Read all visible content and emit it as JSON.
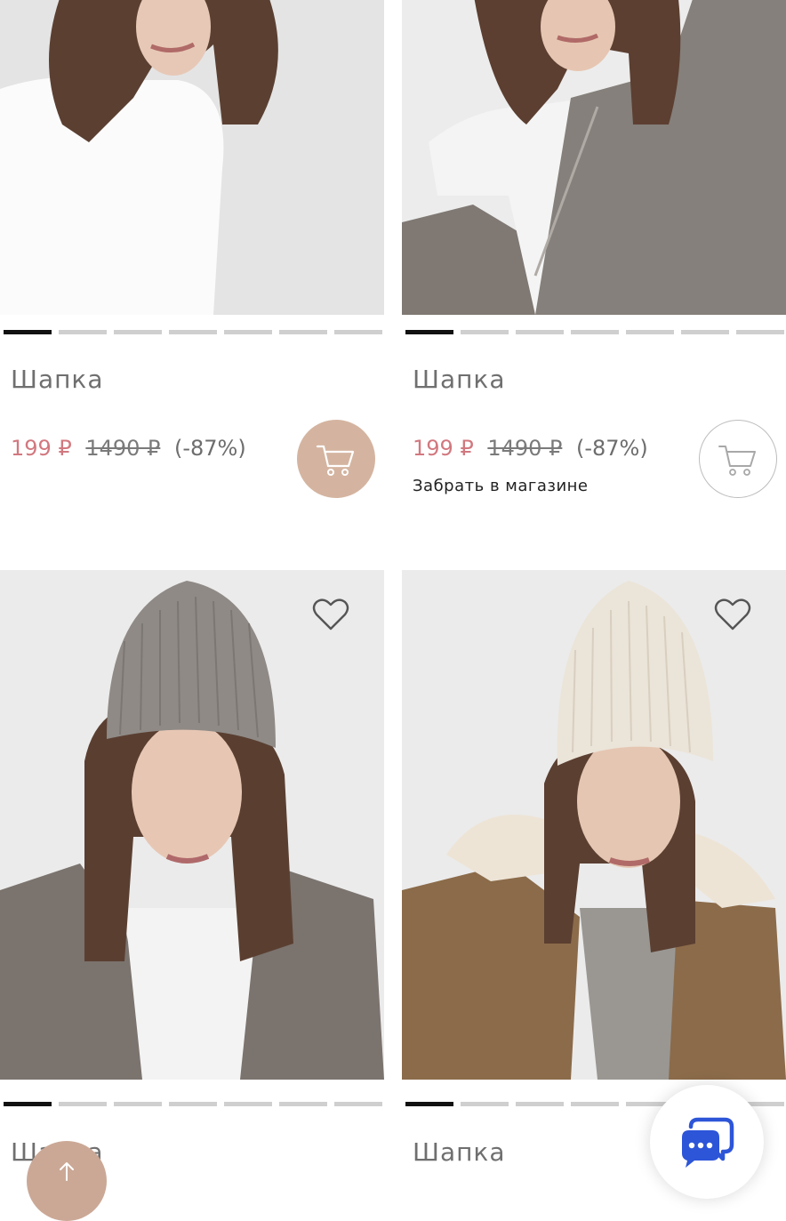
{
  "products": [
    {
      "name": "Шапка",
      "price": "199 ₽",
      "old_price": "1490 ₽",
      "discount": "(-87%)",
      "pickup": "",
      "cart_style": "filled",
      "favorite": false,
      "slide_count": 7,
      "active_slide": 0
    },
    {
      "name": "Шапка",
      "price": "199 ₽",
      "old_price": "1490 ₽",
      "discount": "(-87%)",
      "pickup": "Забрать в магазине",
      "cart_style": "outline",
      "favorite": false,
      "slide_count": 7,
      "active_slide": 0
    },
    {
      "name": "Шапка",
      "favorite": true,
      "slide_count": 7,
      "active_slide": 0
    },
    {
      "name": "Шапка",
      "favorite": true,
      "slide_count": 7,
      "active_slide": 0
    }
  ],
  "icons": {
    "cart": "cart-icon",
    "heart": "heart-icon",
    "scroll_up": "arrow-up-icon",
    "chat": "chat-bubble-icon"
  },
  "colors": {
    "sale_price": "#d2787f",
    "cart_filled": "#d4b4a0",
    "active_dot": "#111111",
    "inactive_dot": "#cfcfcf",
    "chat_icon": "#2d55d8",
    "scroll_up_button": "#cba896"
  }
}
